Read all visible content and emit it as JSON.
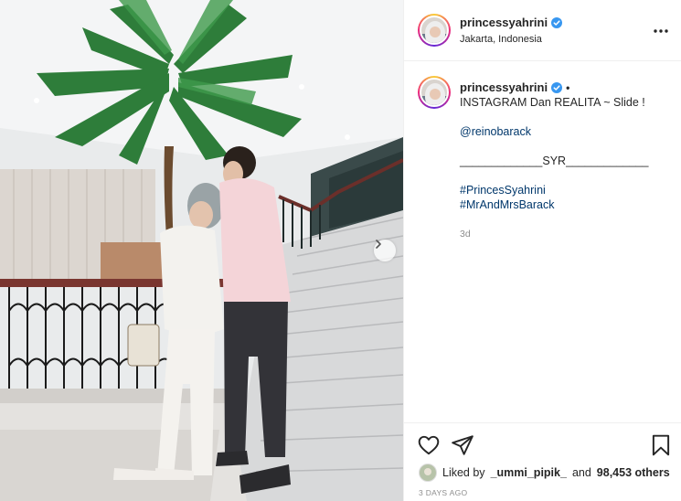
{
  "post": {
    "username": "princessyahrini",
    "location": "Jakarta, Indonesia",
    "verified": true
  },
  "caption": {
    "username": "princessyahrini",
    "separator": "•",
    "line1": "INSTAGRAM Dan REALITA ~ Slide !",
    "mention": "@reinobarack",
    "signature": "_____________SYR_____________",
    "hashtag1": "#PrincesSyahrini",
    "hashtag2": "#MrAndMrsBarack",
    "time": "3d"
  },
  "likes": {
    "prefix": "Liked by",
    "liker": "_ummi_pipik_",
    "joiner": "and",
    "others": "98,453 others"
  },
  "timestamp": "3 DAYS AGO",
  "icons": {
    "more": "more-horizontal-icon",
    "heart": "heart-icon",
    "share": "share-icon",
    "save": "bookmark-icon",
    "next": "chevron-right-icon",
    "verified": "verified-badge-icon"
  },
  "colors": {
    "verified": "#3897f0",
    "link": "#00376b",
    "muted": "#8e8e8e",
    "text": "#262626"
  }
}
